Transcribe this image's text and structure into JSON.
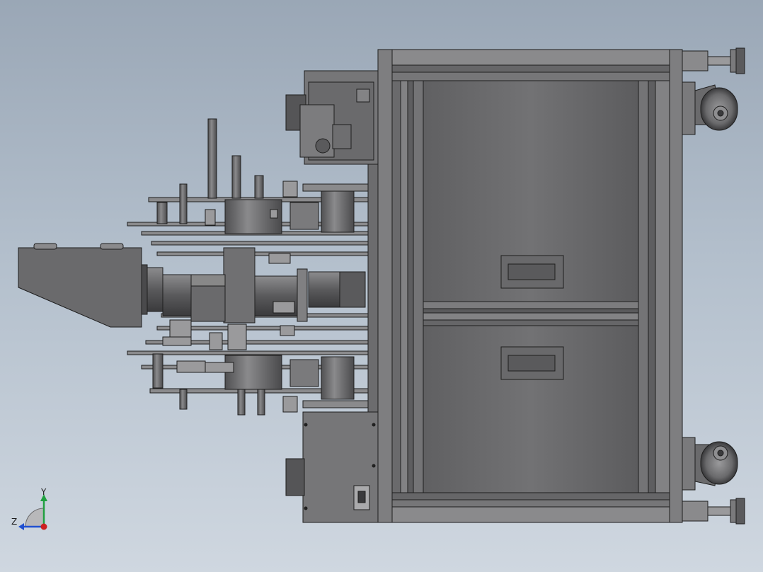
{
  "viewport": {
    "background_top": "#9aa7b6",
    "background_bottom": "#cfd7e0"
  },
  "model": {
    "body_color": "#6e6e70",
    "body_dark": "#4a4a4c",
    "edge_color": "#1e1e1e",
    "highlight": "#a9a9ab"
  },
  "triad": {
    "x_color": "#cc2020",
    "y_color": "#20a040",
    "z_color": "#2050d0",
    "y_label": "Y",
    "z_label": "Z"
  }
}
